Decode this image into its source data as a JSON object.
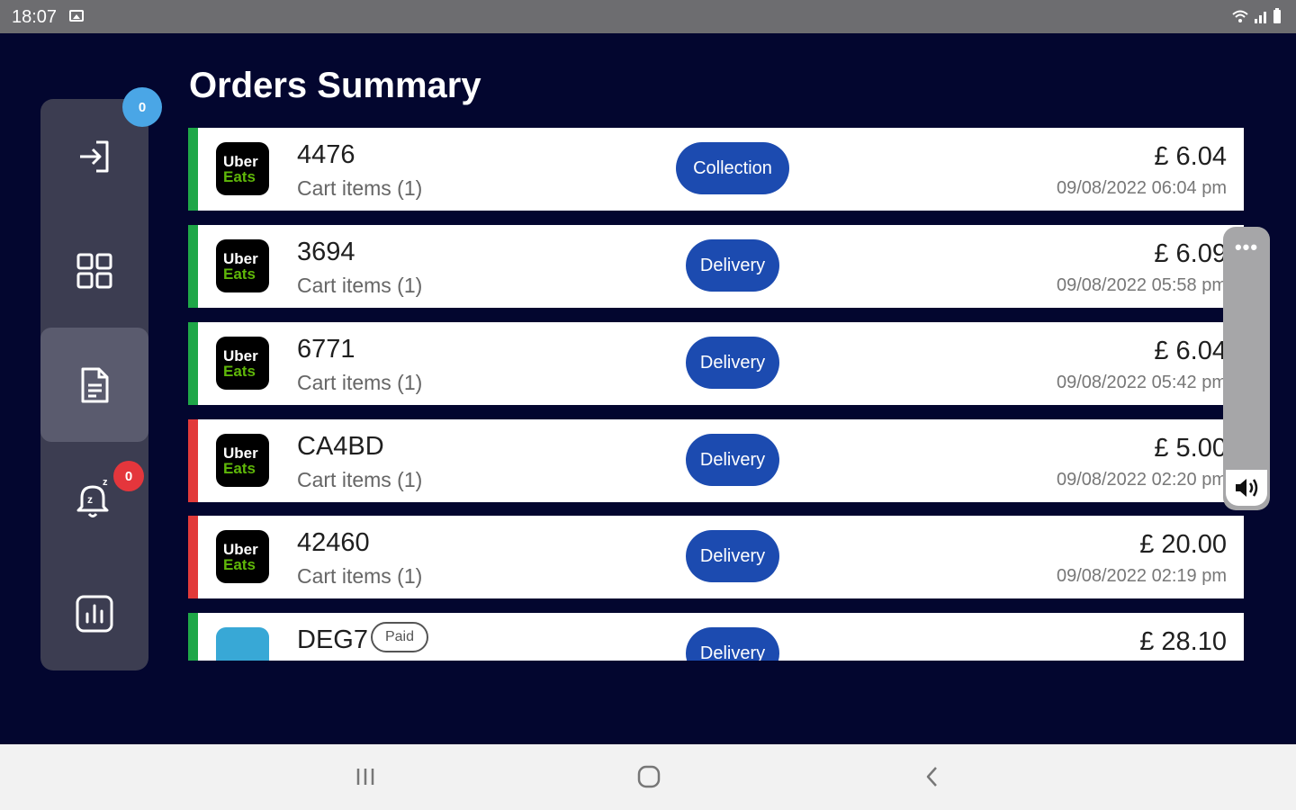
{
  "status_bar": {
    "time": "18:07"
  },
  "page": {
    "title": "Orders Summary"
  },
  "sidebar": {
    "badge_top": "0",
    "badge_alerts": "0",
    "items": [
      {
        "icon": "login-icon"
      },
      {
        "icon": "grid-icon"
      },
      {
        "icon": "document-icon"
      },
      {
        "icon": "snooze-bell-icon"
      },
      {
        "icon": "bar-chart-icon"
      }
    ]
  },
  "orders": [
    {
      "logo_line1": "Uber",
      "logo_line2": "Eats",
      "id": "4476",
      "items": "Cart items (1)",
      "type": "Collection",
      "price": "£ 6.04",
      "date": "09/08/2022 06:04 pm",
      "status_color": "#1fa748"
    },
    {
      "logo_line1": "Uber",
      "logo_line2": "Eats",
      "id": "3694",
      "items": "Cart items (1)",
      "type": "Delivery",
      "price": "£ 6.09",
      "date": "09/08/2022 05:58 pm",
      "status_color": "#1fa748"
    },
    {
      "logo_line1": "Uber",
      "logo_line2": "Eats",
      "id": "6771",
      "items": "Cart items (1)",
      "type": "Delivery",
      "price": "£ 6.04",
      "date": "09/08/2022 05:42 pm",
      "status_color": "#1fa748"
    },
    {
      "logo_line1": "Uber",
      "logo_line2": "Eats",
      "id": "CA4BD",
      "items": "Cart items (1)",
      "type": "Delivery",
      "price": "£ 5.00",
      "date": "09/08/2022 02:20 pm",
      "status_color": "#e23a3a"
    },
    {
      "logo_line1": "Uber",
      "logo_line2": "Eats",
      "id": "42460",
      "items": "Cart items (1)",
      "type": "Delivery",
      "price": "£ 20.00",
      "date": "09/08/2022 02:19 pm",
      "status_color": "#e23a3a"
    },
    {
      "id": "DEG7",
      "paid": "Paid",
      "type": "Delivery",
      "price": "£ 28.10",
      "status_color": "#1fa748"
    }
  ],
  "floating_panel": {
    "more": "•••"
  },
  "colors": {
    "background": "#03062f",
    "sidebar": "#3c3d51",
    "pill": "#1c4bb0",
    "green": "#1fa748",
    "red": "#e23a3a"
  }
}
